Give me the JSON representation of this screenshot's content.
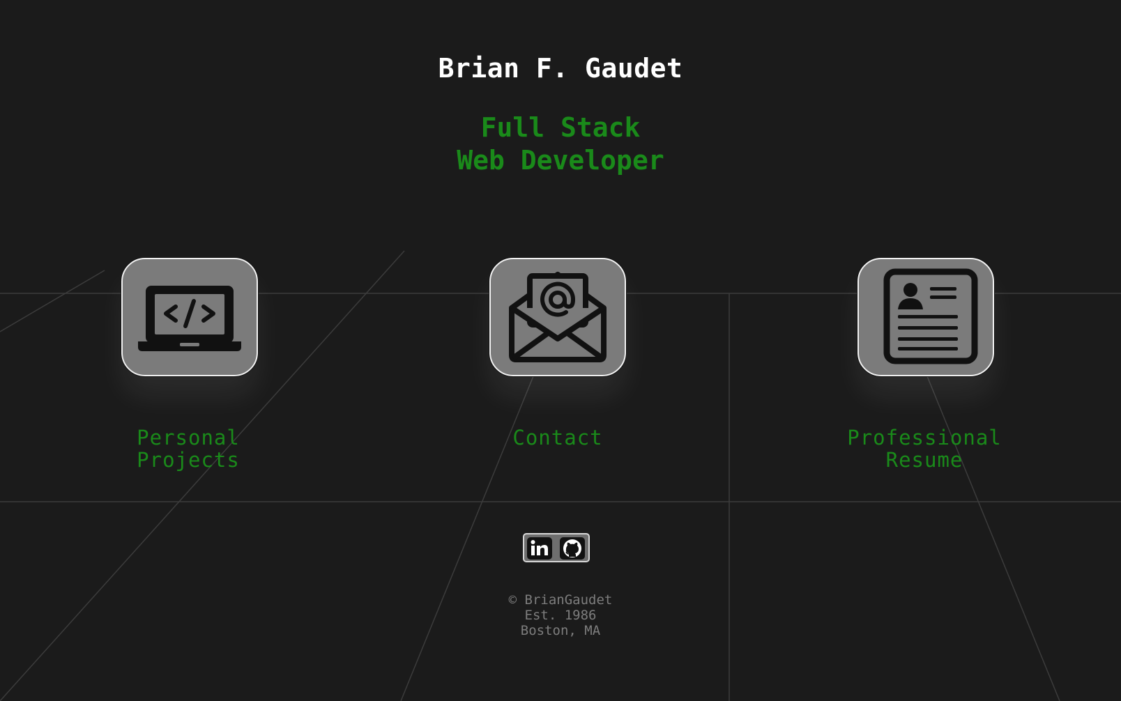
{
  "header": {
    "name": "Brian F. Gaudet",
    "tagline_line1": "Full Stack",
    "tagline_line2": "Web Developer"
  },
  "tiles": [
    {
      "icon": "laptop-code-icon",
      "label_line1": "Personal",
      "label_line2": "Projects"
    },
    {
      "icon": "envelope-at-icon",
      "label_line1": "Contact",
      "label_line2": ""
    },
    {
      "icon": "resume-icon",
      "label_line1": "Professional",
      "label_line2": "Resume"
    }
  ],
  "social": {
    "linkedin_icon": "linkedin-icon",
    "github_icon": "github-icon"
  },
  "footer": {
    "copyright": "© BrianGaudet",
    "established": "Est. 1986",
    "location": "Boston, MA"
  },
  "colors": {
    "background": "#1b1b1b",
    "accent_green": "#1a8a1a",
    "tile_fill": "#7b7b7b",
    "footer_text": "#7d7d7d"
  }
}
